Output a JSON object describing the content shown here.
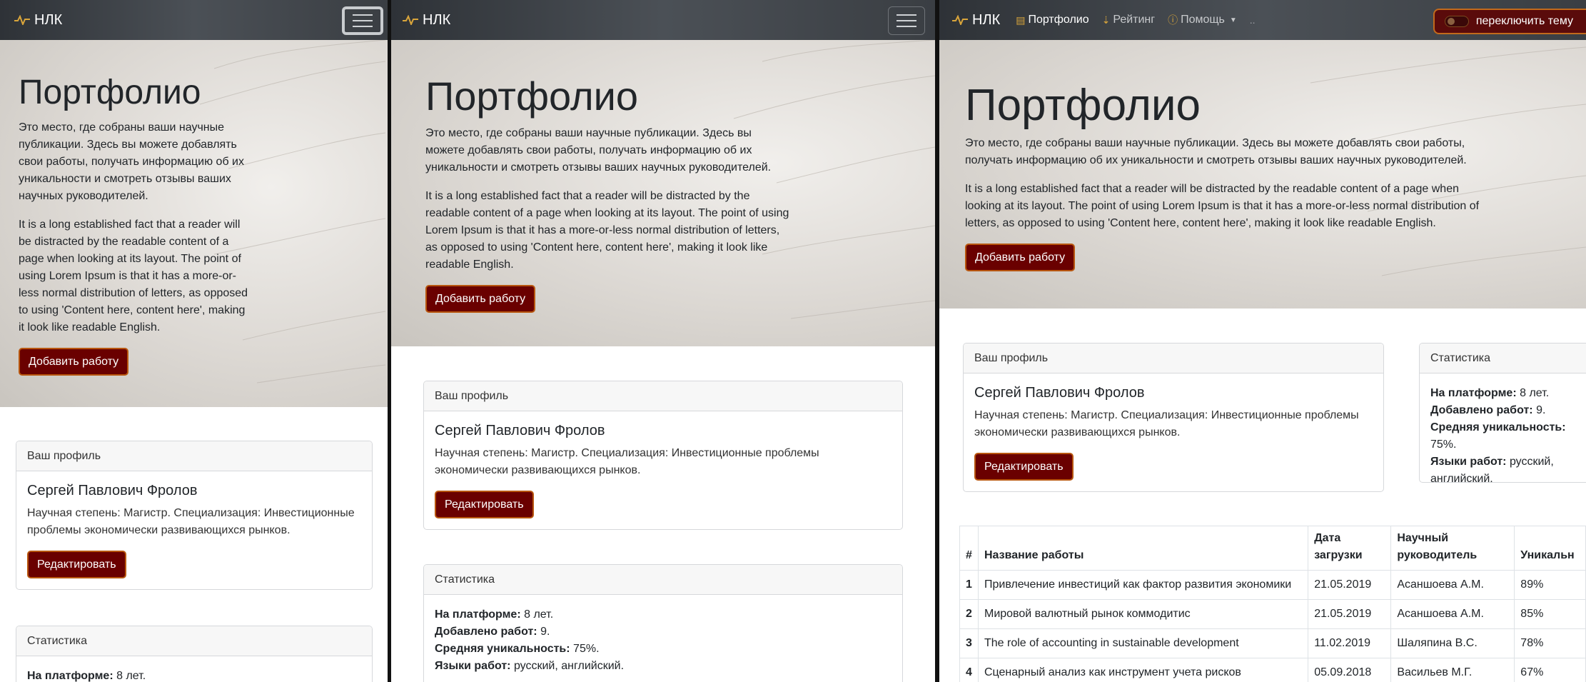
{
  "brand": {
    "name": "НЛК",
    "icon": "pulse-icon",
    "accent": "#d9a53b"
  },
  "colors": {
    "primary_button": "#6a0000",
    "button_border": "#b8560f",
    "navbar": "#3a3e43"
  },
  "nav": {
    "links": [
      {
        "label": "Портфолио",
        "icon": "portfolio-icon",
        "active": true
      },
      {
        "label": "Рейтинг",
        "icon": "ranking-icon",
        "active": false
      },
      {
        "label": "Помощь",
        "icon": "help-circle-icon",
        "active": false,
        "dropdown": true
      }
    ],
    "more": "..",
    "theme_toggle_label": "переключить тему"
  },
  "hero": {
    "title": "Портфолио",
    "lead": "Это место, где собраны ваши научные публикации. Здесь вы можете добавлять свои работы, получать информацию об их уникальности и смотреть отзывы ваших научных руководителей.",
    "body": "It is a long established fact that a reader will be distracted by the readable content of a page when looking at its layout. The point of using Lorem Ipsum is that it has a more-or-less normal distribution of letters, as opposed to using 'Content here, content here', making it look like readable English.",
    "add_button": "Добавить работу"
  },
  "profile": {
    "header": "Ваш профиль",
    "name": "Сергей Павлович Фролов",
    "description": "Научная степень: Магистр. Специализация: Инвестиционные проблемы экономически развивающихся рынков.",
    "edit_button": "Редактировать"
  },
  "stats": {
    "header": "Статистика",
    "items": [
      {
        "label": "На платформе:",
        "value": "8 лет."
      },
      {
        "label": "Добавлено работ:",
        "value": "9."
      },
      {
        "label": "Средняя уникальность:",
        "value": "75%."
      },
      {
        "label": "Языки работ:",
        "value": "русский, английский."
      }
    ]
  },
  "table": {
    "headers": [
      "#",
      "Название работы",
      "Дата загрузки",
      "Научный руководитель",
      "Уникальн"
    ],
    "rows": [
      {
        "num": "1",
        "title": "Привлечение инвестиций как фактор развития экономики",
        "date": "21.05.2019",
        "advisor": "Асаншоева А.М.",
        "uniqueness": "89%"
      },
      {
        "num": "2",
        "title": "Мировой валютный рынок коммодитис",
        "date": "21.05.2019",
        "advisor": "Асаншоева А.М.",
        "uniqueness": "85%"
      },
      {
        "num": "3",
        "title": "The role of accounting in sustainable development",
        "date": "11.02.2019",
        "advisor": "Шаляпина В.С.",
        "uniqueness": "78%"
      },
      {
        "num": "4",
        "title": "Сценарный анализ как инструмент учета рисков",
        "date": "05.09.2018",
        "advisor": "Васильев М.Г.",
        "uniqueness": "67%"
      }
    ]
  }
}
